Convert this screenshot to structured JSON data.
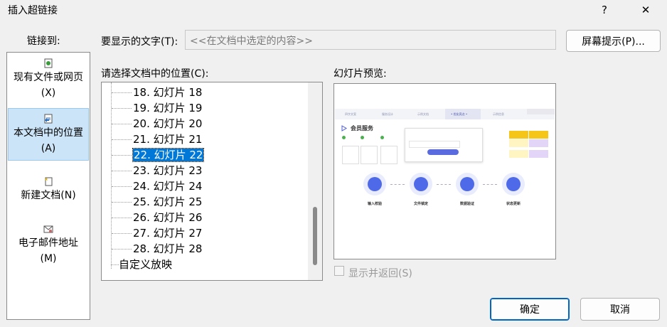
{
  "dialog": {
    "title": "插入超链接",
    "help_button": "?",
    "close_button": "✕"
  },
  "sidebar": {
    "header": "链接到:",
    "items": [
      {
        "line1": "现有文件或网页",
        "line2": "(X)"
      },
      {
        "line1": "本文档中的位置",
        "line2": "(A)"
      },
      {
        "line1": "新建文档(N)",
        "line2": ""
      },
      {
        "line1": "电子邮件地址",
        "line2": "(M)"
      }
    ]
  },
  "display_text": {
    "label": "要显示的文字(T):",
    "value": "<<在文档中选定的内容>>"
  },
  "screentip_button": "屏幕提示(P)...",
  "location": {
    "label": "请选择文档中的位置(C):",
    "items": [
      "18. 幻灯片 18",
      "19. 幻灯片 19",
      "20. 幻灯片 20",
      "21. 幻灯片 21",
      "22. 幻灯片 22",
      "23. 幻灯片 23",
      "24. 幻灯片 24",
      "25. 幻灯片 25",
      "26. 幻灯片 26",
      "27. 幻灯片 27",
      "28. 幻灯片 28"
    ],
    "selected_index": 4,
    "custom_show": "自定义放映"
  },
  "preview": {
    "label": "幻灯片预览:",
    "slide": {
      "heading": "会员服务",
      "tabs": [
        "四字文案",
        "服务设计",
        "示例文档",
        "• 优化亮点 •",
        "示例信息"
      ],
      "steps": [
        "输入校验",
        "文件锁定",
        "数据验证",
        "状态更新"
      ]
    }
  },
  "show_and_return": "显示并返回(S)",
  "ok_button": "确定",
  "cancel_button": "取消"
}
